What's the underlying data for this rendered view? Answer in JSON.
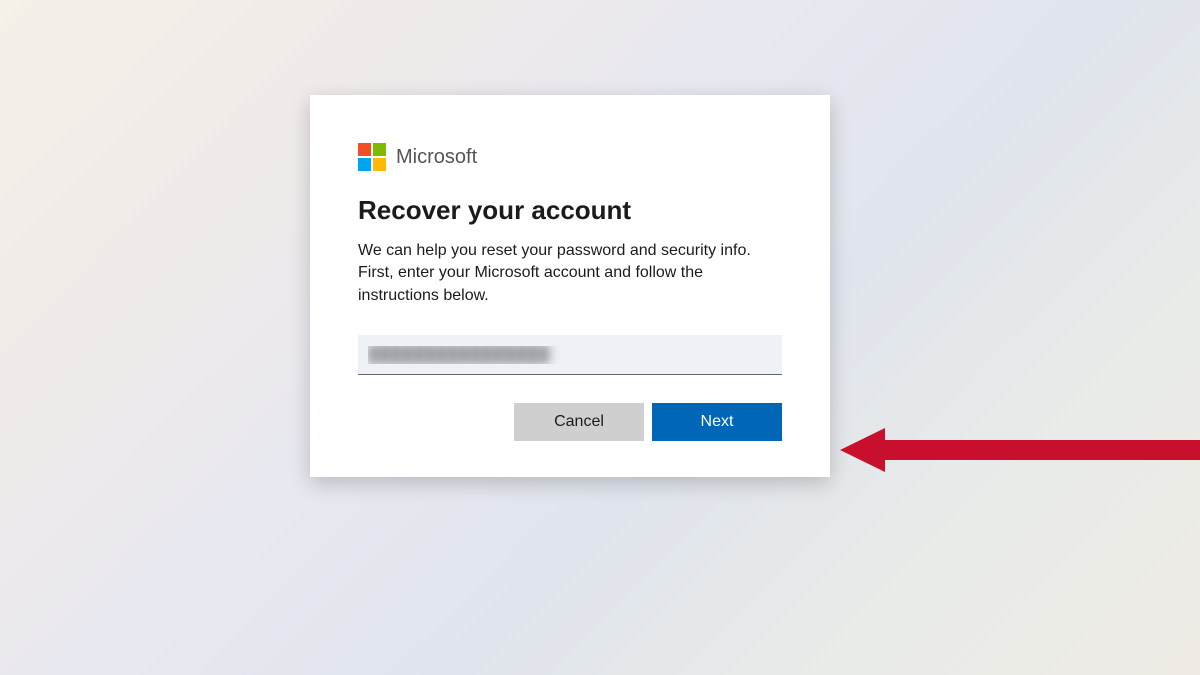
{
  "brand": {
    "name": "Microsoft"
  },
  "dialog": {
    "title": "Recover your account",
    "body": "We can help you reset your password and security info. First, enter your Microsoft account and follow the instructions below.",
    "input_value": "████████████████"
  },
  "buttons": {
    "cancel": "Cancel",
    "next": "Next"
  },
  "colors": {
    "primary": "#0067b8",
    "arrow": "#c8102e"
  }
}
